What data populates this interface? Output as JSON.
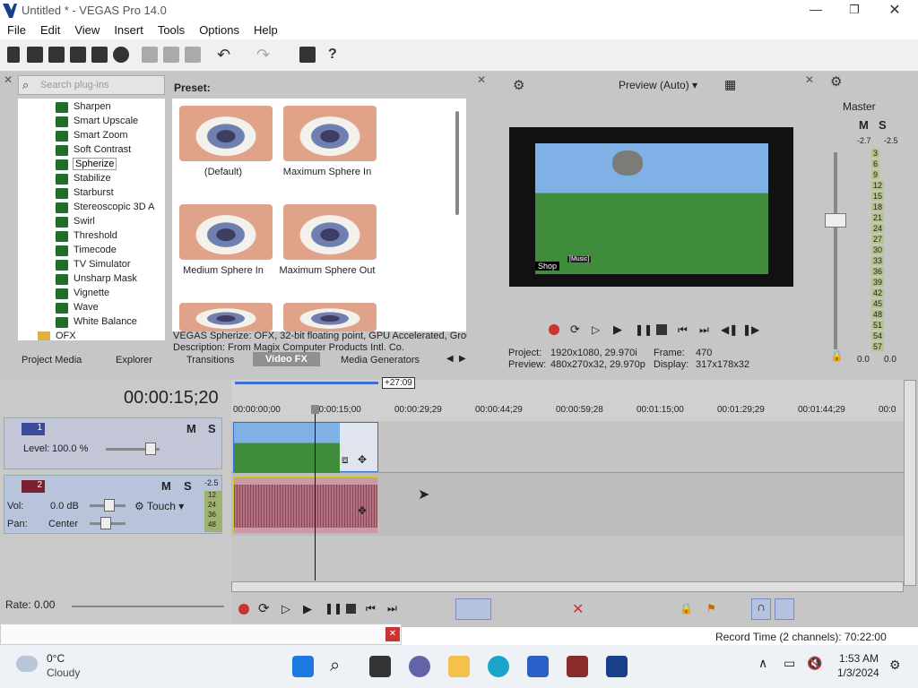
{
  "window": {
    "title": "Untitled * - VEGAS Pro 14.0"
  },
  "menu": [
    "File",
    "Edit",
    "View",
    "Insert",
    "Tools",
    "Options",
    "Help"
  ],
  "plugins": {
    "search_placeholder": "Search plug-ins",
    "items": [
      "Sharpen",
      "Smart Upscale",
      "Smart Zoom",
      "Soft Contrast",
      "Spherize",
      "Stabilize",
      "Starburst",
      "Stereoscopic 3D A",
      "Swirl",
      "Threshold",
      "Timecode",
      "TV Simulator",
      "Unsharp Mask",
      "Vignette",
      "Wave",
      "White Balance"
    ],
    "selected": "Spherize",
    "folder": "OFX"
  },
  "preset": {
    "label": "Preset:",
    "items": [
      "(Default)",
      "Maximum Sphere In",
      "Medium Sphere In",
      "Maximum Sphere Out"
    ],
    "info_line1": "VEGAS Spherize: OFX, 32-bit floating point, GPU Accelerated, Group",
    "info_line2": "Description: From Magix Computer Products Intl. Co."
  },
  "window_tabs": [
    "Project Media",
    "Explorer",
    "Transitions",
    "Video FX",
    "Media Generators"
  ],
  "active_tab": "Video FX",
  "preview": {
    "mode": "Preview (Auto)",
    "project_label": "Project:",
    "project_value": "1920x1080, 29.970i",
    "frame_label": "Frame:",
    "frame_value": "470",
    "preview_label": "Preview:",
    "preview_value": "480x270x32, 29.970p",
    "display_label": "Display:",
    "display_value": "317x178x32",
    "video_badge_shop": "Shop",
    "video_badge_music": "[Music]"
  },
  "master": {
    "label": "Master",
    "m": "M",
    "s": "S",
    "top_left": "-2.7",
    "top_right": "-2.5",
    "scale": [
      "3",
      "6",
      "9",
      "12",
      "15",
      "18",
      "21",
      "24",
      "27",
      "30",
      "33",
      "36",
      "39",
      "42",
      "45",
      "48",
      "51",
      "54",
      "57"
    ],
    "bottom_left": "0.0",
    "bottom_right": "0.0"
  },
  "timeline": {
    "timecode": "00:00:15;20",
    "loop_marker": "+27:09",
    "ruler": [
      "00:00:00;00",
      "00:00:15;00",
      "00:00:29;29",
      "00:00:44;29",
      "00:00:59;28",
      "00:01:15;00",
      "00:01:29;29",
      "00:01:44;29",
      "00:0"
    ],
    "video_track": {
      "number": "1",
      "level_label": "Level:",
      "level_value": "100.0 %",
      "m": "M",
      "s": "S"
    },
    "audio_track": {
      "number": "2",
      "vol_label": "Vol:",
      "vol_value": "0.0 dB",
      "pan_label": "Pan:",
      "pan_value": "Center",
      "mode": "Touch",
      "m": "M",
      "s": "S",
      "meter_top": "-2.5",
      "meter": [
        "12",
        "24",
        "36",
        "48"
      ]
    },
    "rate": "Rate: 0.00",
    "record_time": "Record Time (2 channels): 70:22:00"
  },
  "weather": {
    "temp": "0°C",
    "cond": "Cloudy"
  },
  "clock": {
    "time": "1:53 AM",
    "date": "1/3/2024"
  },
  "colors": {
    "accent": "#2c4fa0",
    "track_video": "#3b4a9c",
    "track_audio": "#7a2030",
    "audio_clip": "#c99aa5"
  }
}
